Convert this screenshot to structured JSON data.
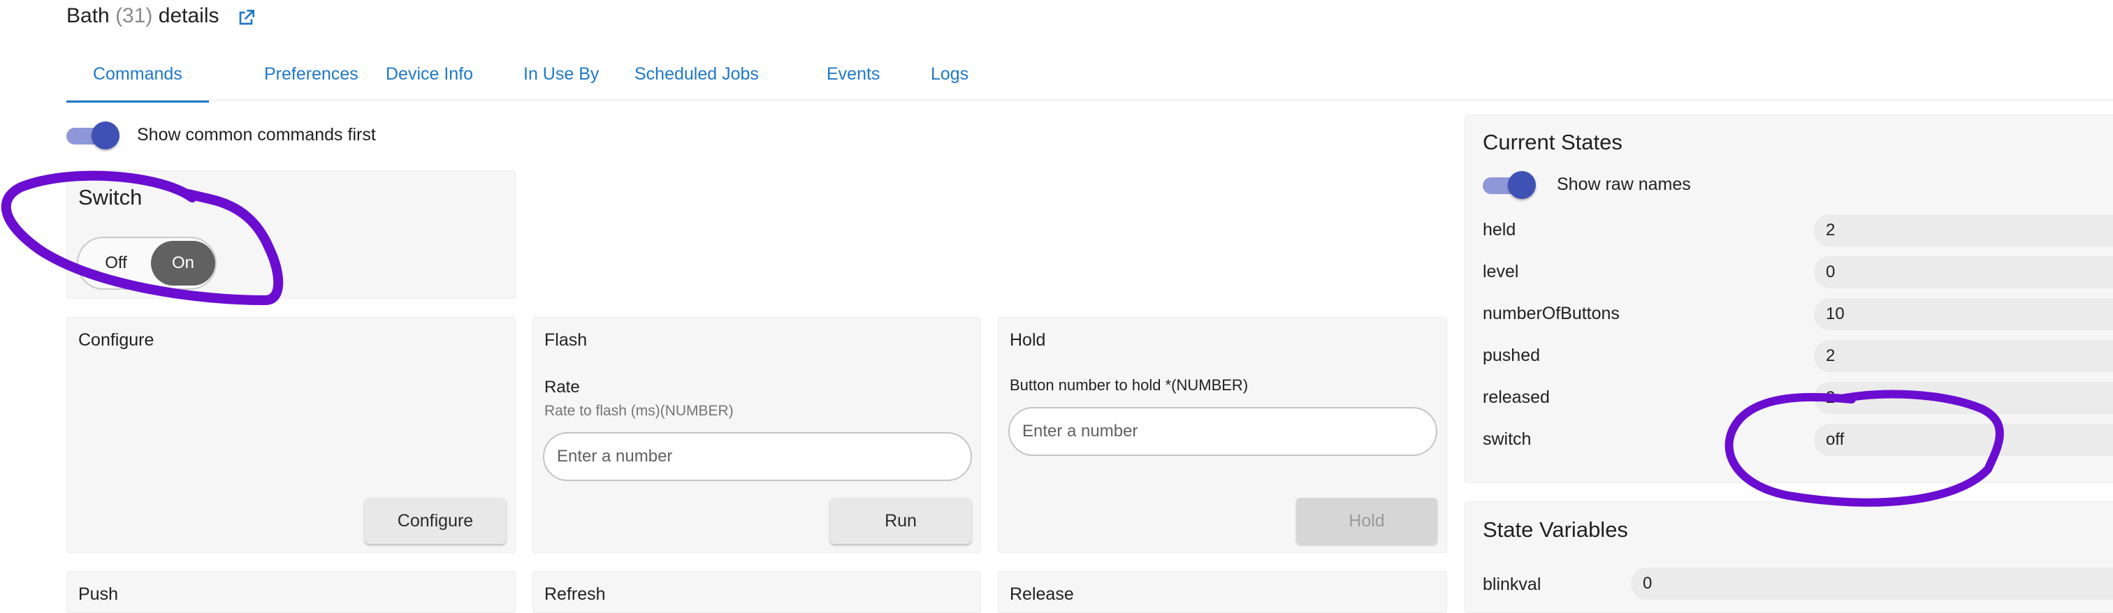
{
  "page": {
    "title_prefix": "Bath",
    "title_count": "(31)",
    "title_suffix": "details",
    "external_link_icon": "external-link-icon"
  },
  "tabs": [
    {
      "label": "Commands",
      "active": true
    },
    {
      "label": "Preferences"
    },
    {
      "label": "Device Info"
    },
    {
      "label": "In Use By"
    },
    {
      "label": "Scheduled Jobs"
    },
    {
      "label": "Events"
    },
    {
      "label": "Logs"
    }
  ],
  "commands": {
    "common_first_label": "Show common commands first",
    "common_first_on": true,
    "switch_card": {
      "title": "Switch",
      "off_label": "Off",
      "on_label": "On",
      "selected": "On"
    },
    "configure_card": {
      "title": "Configure",
      "button": "Configure"
    },
    "flash_card": {
      "title": "Flash",
      "field_label": "Rate",
      "field_help": "Rate to flash (ms)(NUMBER)",
      "placeholder": "Enter a number",
      "button": "Run"
    },
    "hold_card": {
      "title": "Hold",
      "field_label": "Button number to hold *(NUMBER)",
      "placeholder": "Enter a number",
      "button": "Hold",
      "button_disabled": true
    },
    "bottom_cards": [
      "Push",
      "Refresh",
      "Release"
    ]
  },
  "current_states": {
    "title": "Current States",
    "raw_names_label": "Show raw names",
    "raw_names_on": true,
    "rows": [
      {
        "name": "held",
        "value": "2"
      },
      {
        "name": "level",
        "value": "0"
      },
      {
        "name": "numberOfButtons",
        "value": "10"
      },
      {
        "name": "pushed",
        "value": "2"
      },
      {
        "name": "released",
        "value": "2"
      },
      {
        "name": "switch",
        "value": "off"
      }
    ]
  },
  "state_variables": {
    "title": "State Variables",
    "rows": [
      {
        "name": "blinkval",
        "value": "0"
      }
    ]
  },
  "colors": {
    "accent": "#1f78c8",
    "toggle": "#3f51b5",
    "annotation": "#6a0dd0"
  }
}
